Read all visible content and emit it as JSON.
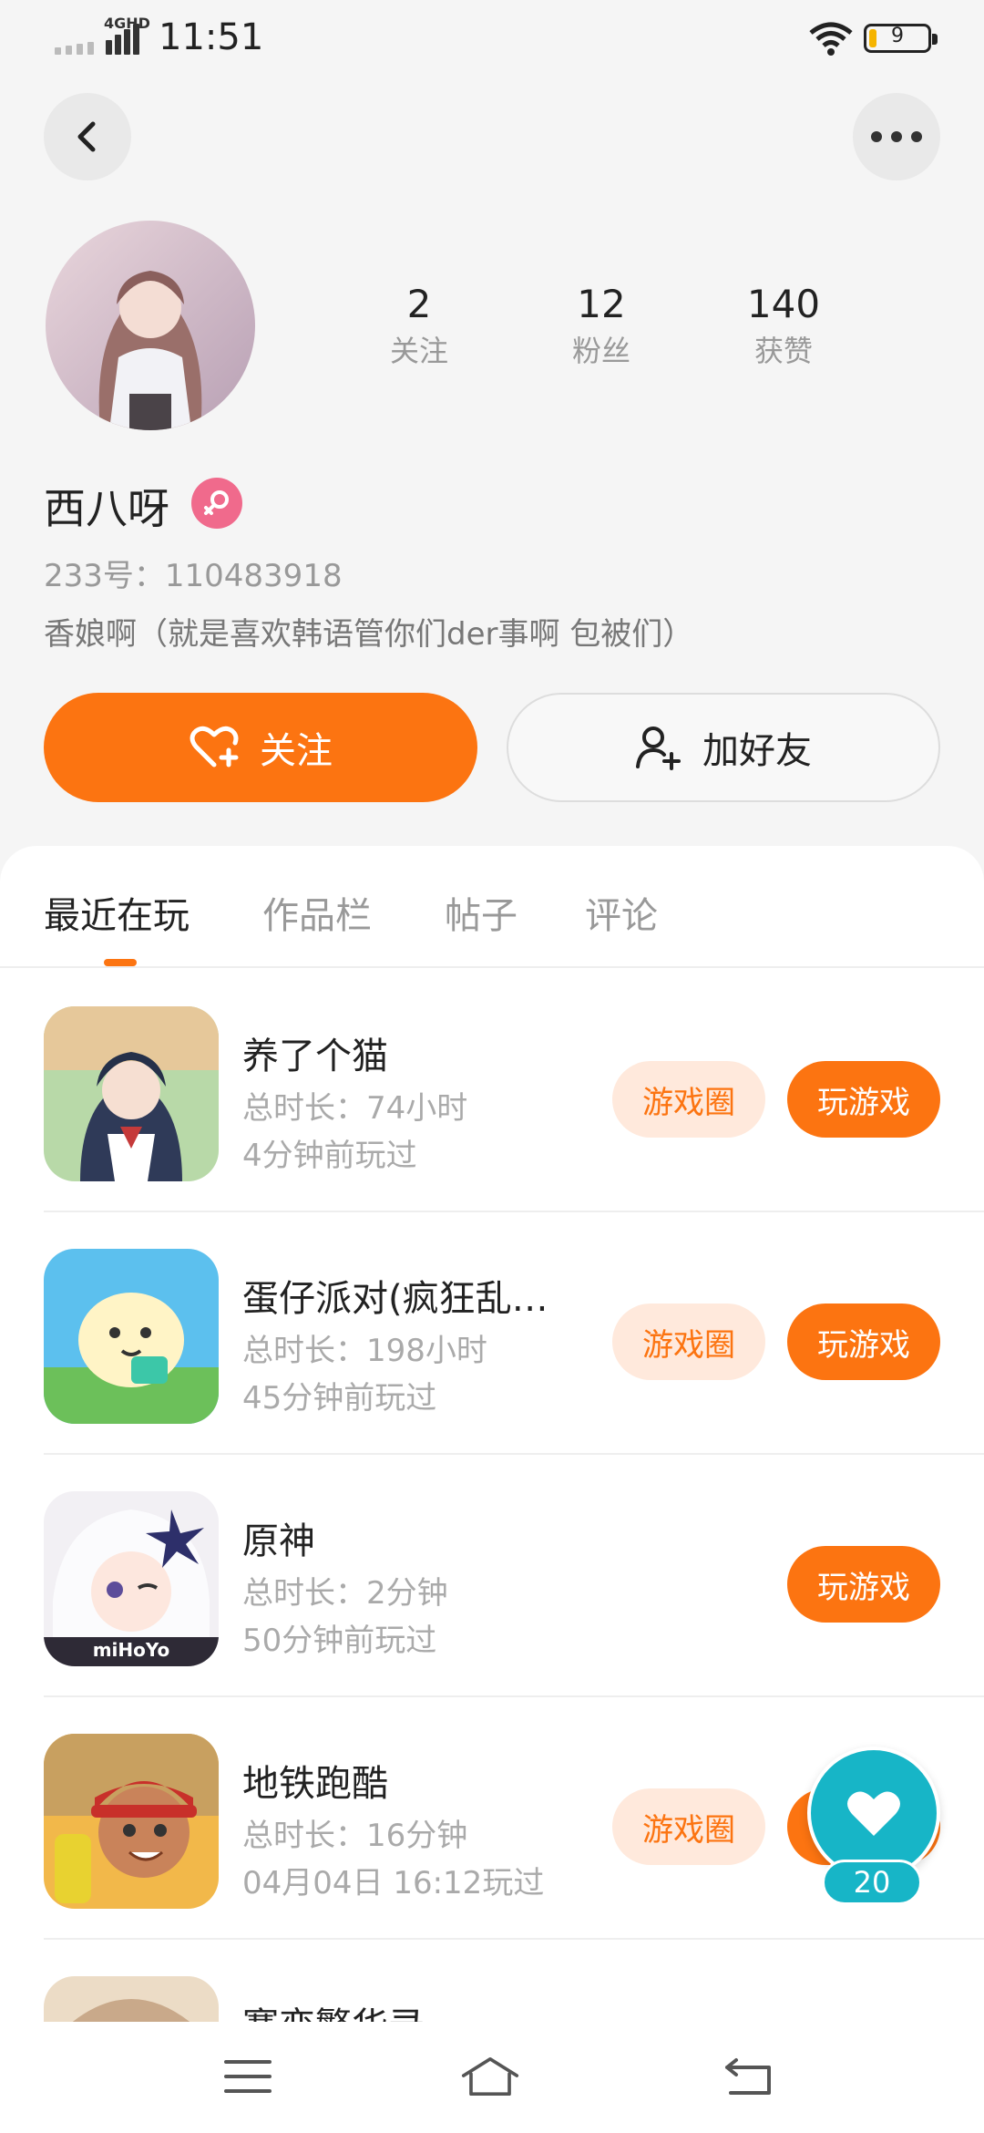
{
  "status_bar": {
    "time": "11:51",
    "network": "4GHD",
    "battery_level": "9"
  },
  "header": {
    "back_icon": "chevron-left-icon",
    "more_icon": "more-dots-icon"
  },
  "profile": {
    "username": "西八呀",
    "gender_icon": "female-icon",
    "uid": "233号：110483918",
    "bio": "香娘啊（就是喜欢韩语管你们der事啊 包被们）",
    "stats": [
      {
        "value": "2",
        "label": "关注"
      },
      {
        "value": "12",
        "label": "粉丝"
      },
      {
        "value": "140",
        "label": "获赞"
      }
    ],
    "follow_label": "关注",
    "add_friend_label": "加好友"
  },
  "tabs": [
    {
      "label": "最近在玩",
      "active": true
    },
    {
      "label": "作品栏",
      "active": false
    },
    {
      "label": "帖子",
      "active": false
    },
    {
      "label": "评论",
      "active": false
    }
  ],
  "games": [
    {
      "name": "养了个猫",
      "duration": "总时长：74小时",
      "last_played": "4分钟前玩过",
      "circle_label": "游戏圈",
      "play_label": "玩游戏"
    },
    {
      "name": "蛋仔派对(疯狂乱…",
      "duration": "总时长：198小时",
      "last_played": "45分钟前玩过",
      "circle_label": "游戏圈",
      "play_label": "玩游戏"
    },
    {
      "name": "原神",
      "duration": "总时长：2分钟",
      "last_played": "50分钟前玩过",
      "play_label": "玩游戏",
      "icon_text": "miHoYo"
    },
    {
      "name": "地铁跑酷",
      "duration": "总时长：16分钟",
      "last_played": "04月04日 16:12玩过",
      "circle_label": "游戏圈",
      "play_label": "玩游戏"
    },
    {
      "name": "赛恋繁华录"
    }
  ],
  "floating_like": {
    "count": "20"
  },
  "colors": {
    "accent": "#fc7411",
    "accent_light": "#ffe9dc",
    "like_button": "#17b5c7",
    "gender_badge": "#f06a8c"
  }
}
